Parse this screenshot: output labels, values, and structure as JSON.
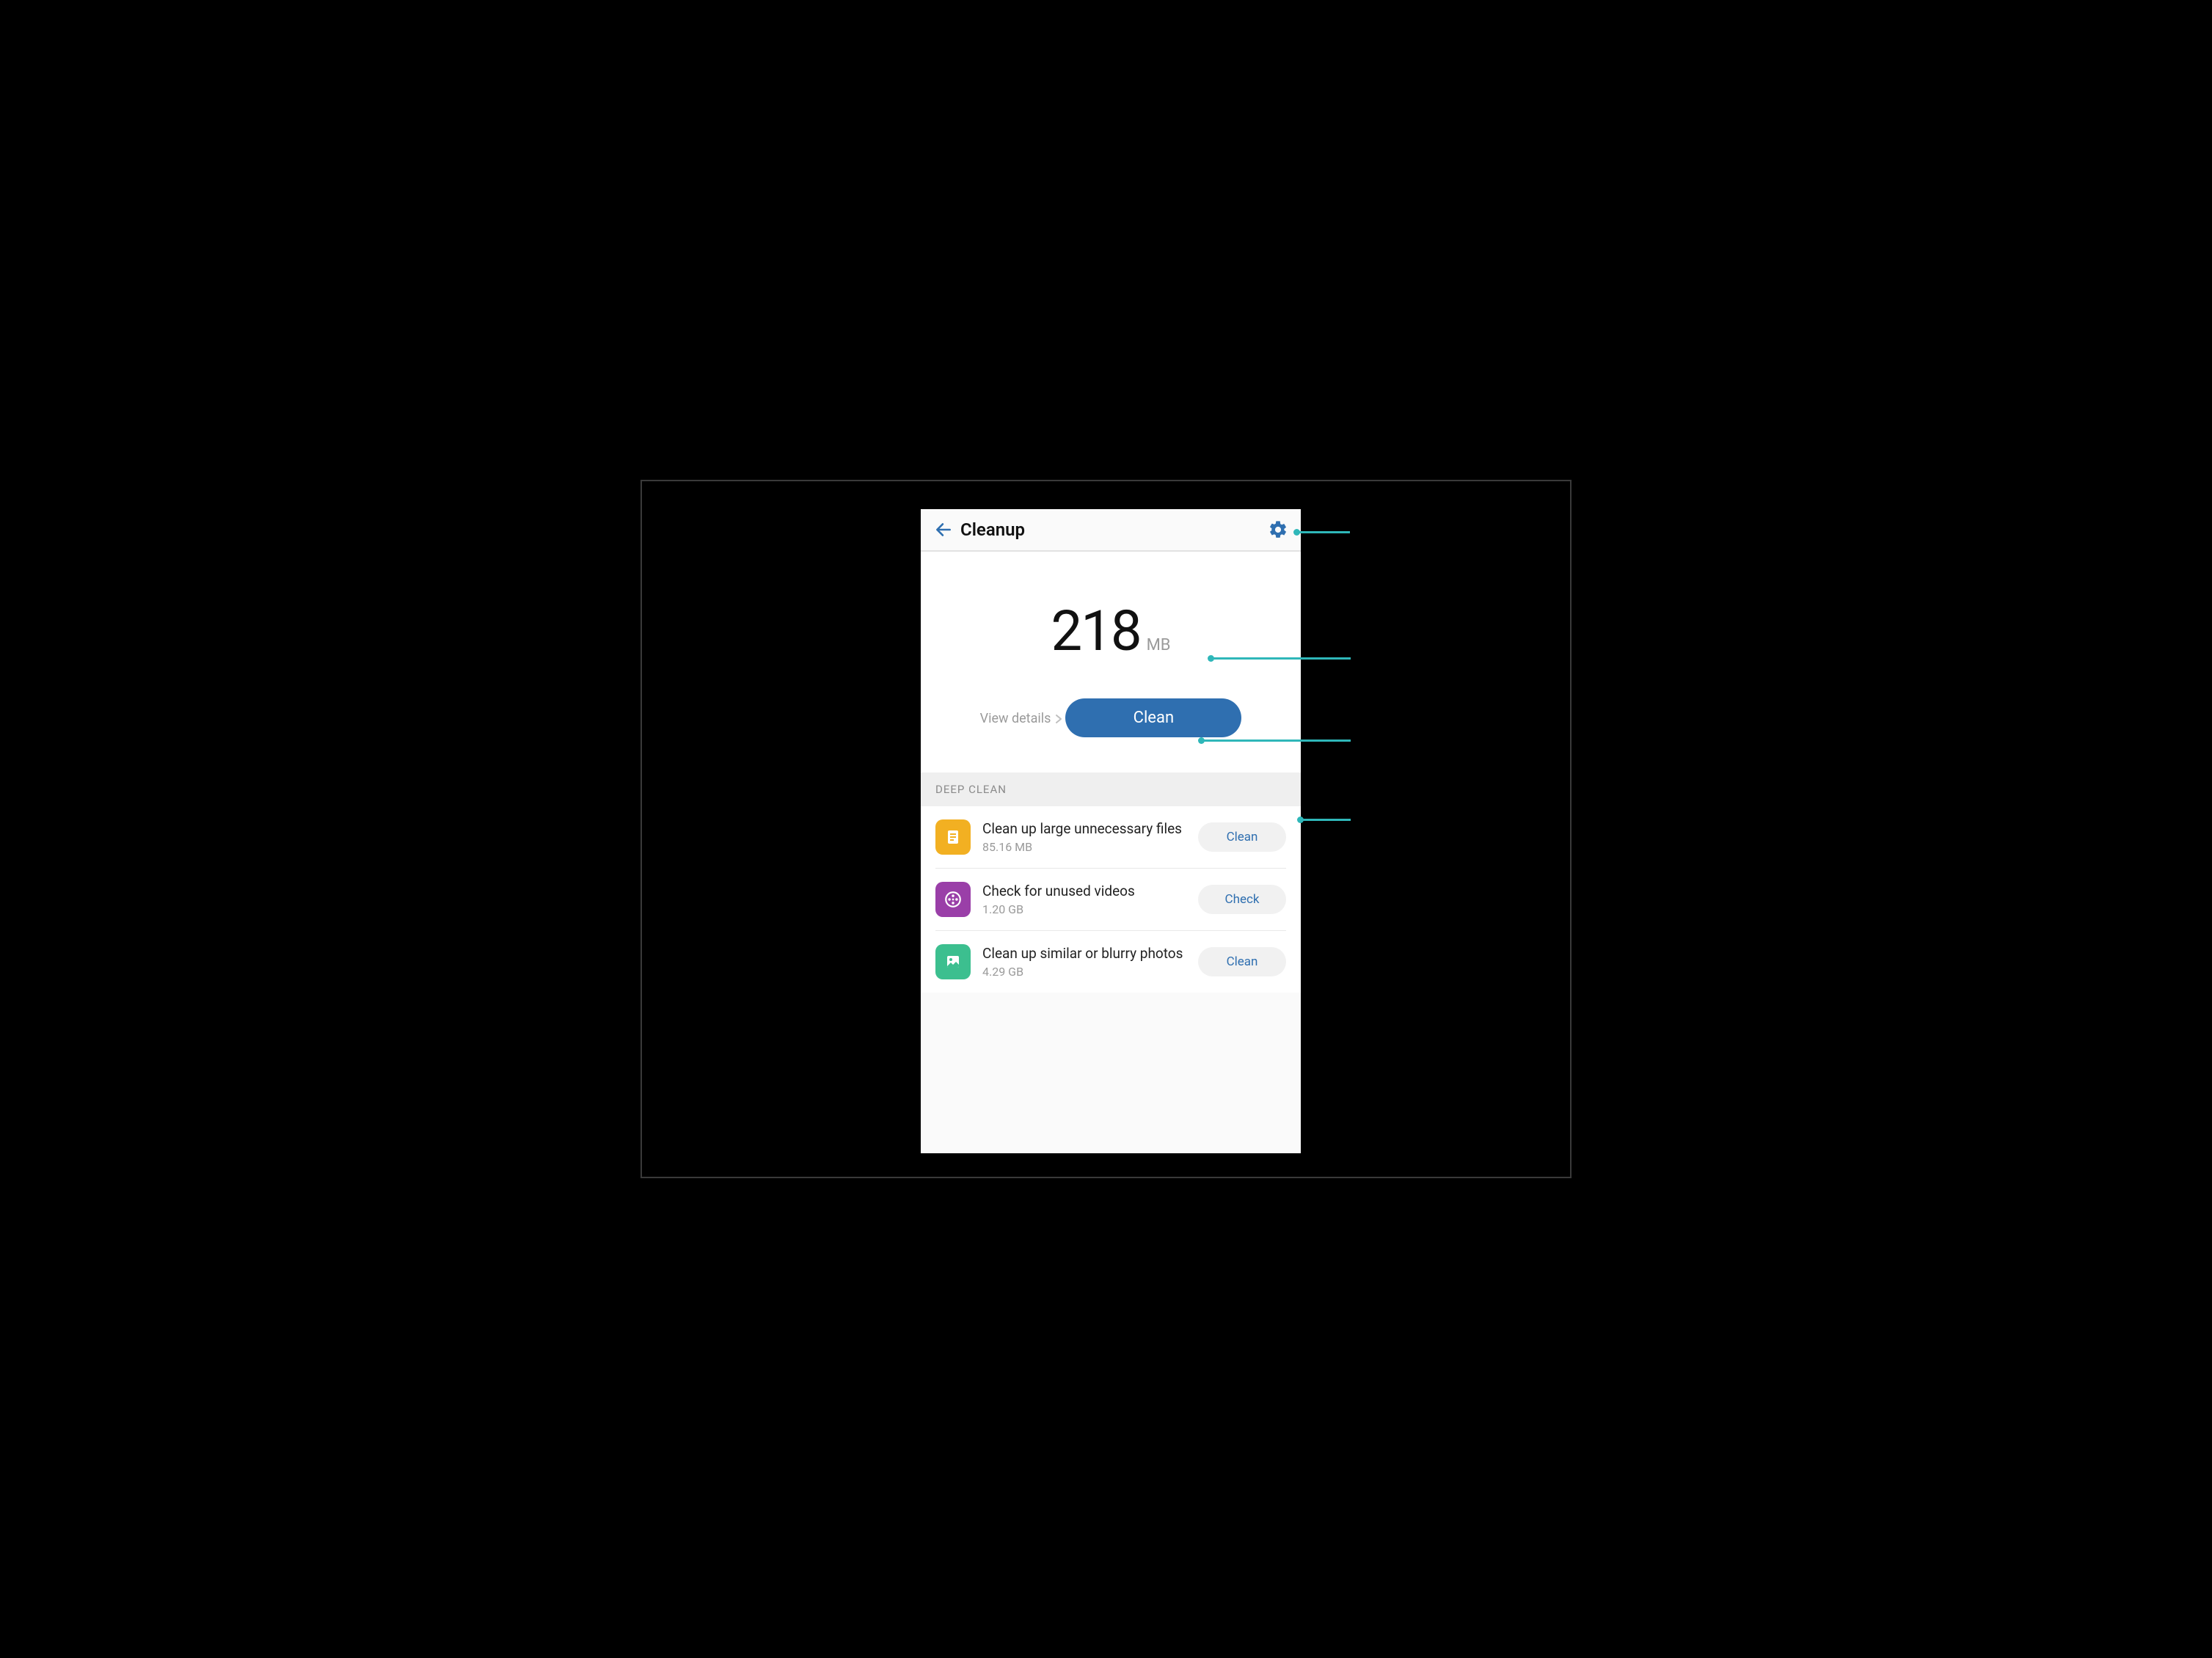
{
  "header": {
    "title": "Cleanup"
  },
  "top": {
    "amount": "218",
    "unit": "MB",
    "view_details": "View details",
    "clean_label": "Clean"
  },
  "section": {
    "deep_clean": "DEEP CLEAN"
  },
  "rows": [
    {
      "title": "Clean up large unnecessary files",
      "sub": "85.16 MB",
      "action": "Clean"
    },
    {
      "title": "Check for unused videos",
      "sub": "1.20 GB",
      "action": "Check"
    },
    {
      "title": "Clean up similar or blurry photos",
      "sub": "4.29 GB",
      "action": "Clean"
    }
  ],
  "colors": {
    "accent": "#2f6fb0",
    "teal": "#2fb7b9"
  }
}
